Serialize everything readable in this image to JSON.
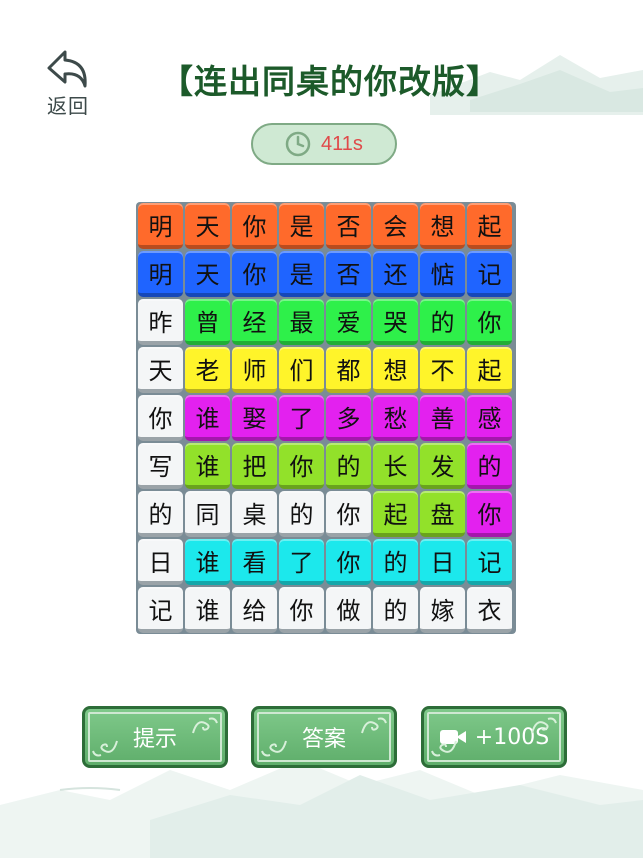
{
  "back": {
    "label": "返回",
    "icon": "back-arrow-icon"
  },
  "title": "【连出同桌的你改版】",
  "timer": {
    "icon": "clock-icon",
    "value": "411s"
  },
  "grid": {
    "rows": [
      [
        "明",
        "天",
        "你",
        "是",
        "否",
        "会",
        "想",
        "起"
      ],
      [
        "明",
        "天",
        "你",
        "是",
        "否",
        "还",
        "惦",
        "记"
      ],
      [
        "昨",
        "曾",
        "经",
        "最",
        "爱",
        "哭",
        "的",
        "你"
      ],
      [
        "天",
        "老",
        "师",
        "们",
        "都",
        "想",
        "不",
        "起"
      ],
      [
        "你",
        "谁",
        "娶",
        "了",
        "多",
        "愁",
        "善",
        "感"
      ],
      [
        "写",
        "谁",
        "把",
        "你",
        "的",
        "长",
        "发",
        "的"
      ],
      [
        "的",
        "同",
        "桌",
        "的",
        "你",
        "起",
        "盘",
        "你"
      ],
      [
        "日",
        "谁",
        "看",
        "了",
        "你",
        "的",
        "日",
        "记"
      ],
      [
        "记",
        "谁",
        "给",
        "你",
        "做",
        "的",
        "嫁",
        "衣"
      ]
    ],
    "colors": [
      [
        "orange",
        "orange",
        "orange",
        "orange",
        "orange",
        "orange",
        "orange",
        "orange"
      ],
      [
        "blue",
        "blue",
        "blue",
        "blue",
        "blue",
        "blue",
        "blue",
        "blue"
      ],
      [
        "white",
        "green",
        "green",
        "green",
        "green",
        "green",
        "green",
        "green"
      ],
      [
        "white",
        "yellow",
        "yellow",
        "yellow",
        "yellow",
        "yellow",
        "yellow",
        "yellow"
      ],
      [
        "white",
        "magenta",
        "magenta",
        "magenta",
        "magenta",
        "magenta",
        "magenta",
        "magenta"
      ],
      [
        "white",
        "lime",
        "lime",
        "lime",
        "lime",
        "lime",
        "lime",
        "magenta"
      ],
      [
        "white",
        "white",
        "white",
        "white",
        "white",
        "lime",
        "lime",
        "magenta"
      ],
      [
        "white",
        "cyan",
        "cyan",
        "cyan",
        "cyan",
        "cyan",
        "cyan",
        "cyan"
      ],
      [
        "white",
        "white",
        "white",
        "white",
        "white",
        "white",
        "white",
        "white"
      ]
    ]
  },
  "buttons": {
    "hint": "提示",
    "answer": "答案",
    "time_bonus": "+100S",
    "time_bonus_icon": "video-camera-icon"
  }
}
